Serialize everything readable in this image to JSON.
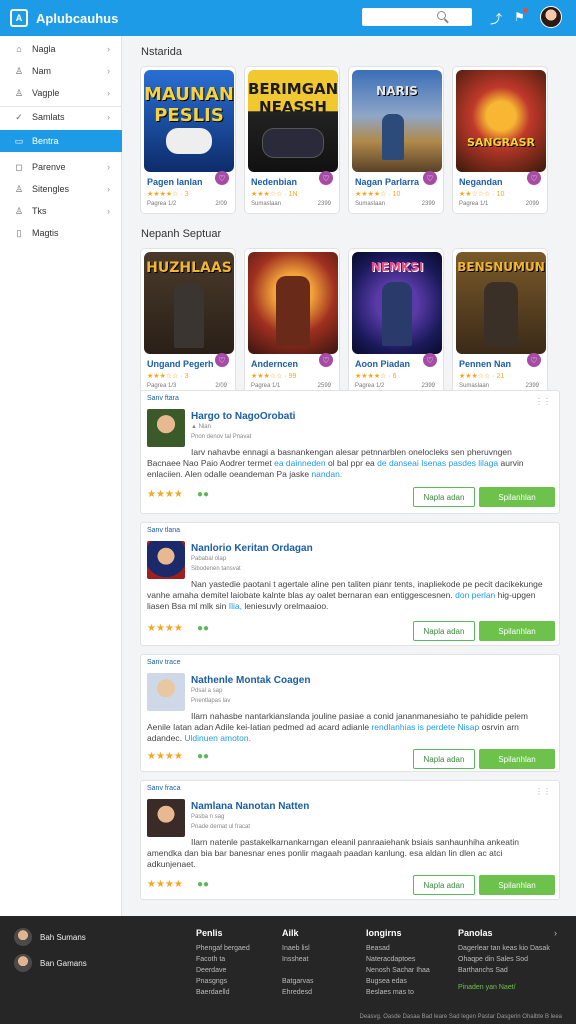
{
  "header": {
    "title": "Aplubcauhus",
    "logo_text": "A",
    "search_placeholder": "",
    "icons": [
      "search-icon",
      "share-icon",
      "notification-icon",
      "avatar"
    ]
  },
  "sidebar": {
    "items": [
      {
        "label": "Nagla",
        "icon": "home-icon"
      },
      {
        "label": "Nam",
        "icon": "user-icon"
      },
      {
        "label": "Vagple",
        "icon": "user-icon"
      },
      {
        "label": "Samlats",
        "icon": "check-icon"
      },
      {
        "label": "Bentra",
        "icon": "grid-icon",
        "active": true
      },
      {
        "label": "Parenve",
        "icon": "chat-icon"
      },
      {
        "label": "Sitengles",
        "icon": "people-icon"
      },
      {
        "label": "Tks",
        "icon": "person-icon"
      },
      {
        "label": "Magtis",
        "icon": "doc-icon"
      }
    ]
  },
  "sections": {
    "featured_title": "Nstarida",
    "popular_title": "Nepanh Septuar"
  },
  "featured_games": [
    {
      "art": "MAUNAN PESLIS",
      "name": "Pagen lanlan",
      "rating": "★★★★☆ · 3",
      "count": "39",
      "sub": "Pagrea 1/2",
      "num": "2/09"
    },
    {
      "art": "BERIMGAN NEASSH",
      "name": "Nedenbian",
      "rating": "★★★☆☆ · 1N",
      "count": "1N",
      "sub": "Sumaslaan",
      "num": "2399"
    },
    {
      "art": "NARIS",
      "name": "Nagan Parlarra",
      "rating": "★★★★☆ · 10",
      "count": "10",
      "sub": "Sumaslaan",
      "num": "2399"
    },
    {
      "art": "SANGRASR",
      "name": "Negandan",
      "rating": "★★☆☆☆ · 10",
      "count": "10",
      "sub": "Pagrea 1/1",
      "num": "2099"
    }
  ],
  "popular_games": [
    {
      "art": "HUZHLAAS",
      "name": "Ungand Pegerh",
      "rating": "★★★☆☆ · 3",
      "count": "80",
      "sub": "Pagrea 1/3",
      "num": "2/09"
    },
    {
      "art": "",
      "name": "Anderncen",
      "rating": "★★★☆☆ · 99",
      "count": "99",
      "sub": "Pagrea 1/1",
      "num": "2599"
    },
    {
      "art": "NEMKSI",
      "name": "Aoon Piadan",
      "rating": "★★★★☆ · 6",
      "count": "6",
      "sub": "Pagrea 1/2",
      "num": "2399"
    },
    {
      "art": "BENSNUMUN",
      "name": "Pennen Nan",
      "rating": "★★★☆☆ · 21",
      "count": "21",
      "sub": "Sumaslaan",
      "num": "2399"
    }
  ],
  "posts": [
    {
      "tag": "Sanv ftara",
      "title": "Hargo to NagoOrobati",
      "meta1": "▲ Nlan",
      "meta2": "Pnon denov tal Pnavat",
      "body_a": "Iarv nahavbe ennagi a basnankengan alesar petnnarblen onelocleks sen pheruvngen Bacnaee Nao Paio Aodrer termet ",
      "body_hl1": "ea dainneden",
      "body_b": " ol bal ppr ea ",
      "body_hl2": "de danseai Isenas pasdes lilaga",
      "body_c": " aurvin enlaciien. Alen odalle oeandeman Pa jaske ",
      "body_hl3": "nandan.",
      "stars": "★★★★",
      "btn1": "Napla adan",
      "btn2": "Spilanhlan"
    },
    {
      "tag": "Sanv tlana",
      "title": "Nanlorio Keritan Ordagan",
      "meta1": "Pababal olap",
      "meta2": "Sibodenen tansvat",
      "body_a": "Nan yastedie paotani t agertale aline pen taliten pianr tents, inapliekode pe pecit dacikekunge vanhe amaha demitel laiobate kalnte blas ay oalet bernaran ean entiggescesnen. ",
      "body_hl1": "don perlan",
      "body_b": " hig-upgen liasen Bsa ml mlk sin ",
      "body_hl2": "Ilia,",
      "body_c": " leniesuvly orelmaaioo. ",
      "body_hl3": "",
      "stars": "★★★★",
      "btn1": "Napla adan",
      "btn2": "Spilanhlan"
    },
    {
      "tag": "Sanv trace",
      "title": "Nathenle Montak Coagen",
      "meta1": "Pdsal a sap",
      "meta2": "Pnentlapas lav",
      "body_a": "Ilarn nahasbe nantarkianslanda jouline pasiae a conid jananmanesiaho te pahidide pelem Aenile Iatan adan Adile kei-Iatian pedmed ad acard adianle ",
      "body_hl1": "rendlanhias is perdete Nisap",
      "body_b": " osrvin arn adandec. ",
      "body_hl2": "Uldinuen amoton.",
      "body_c": "",
      "body_hl3": "",
      "stars": "★★★★",
      "btn1": "Napla adan",
      "btn2": "Spilanhlan"
    },
    {
      "tag": "Sanv fraca",
      "title": "Namlana Nanotan Natten",
      "meta1": "Pasba n sag",
      "meta2": "Pnade dernat ul fracat",
      "body_a": "Ilarn natenle pastakelkarnankarngan eleanil panraaiehank bsiais sanhaunhiha ankeatin amendka dan bia bar banesnar enes ponlir magaah paadan kanlung. esa aldan lin dlen ac atci adkunjenaet.",
      "body_hl1": "",
      "body_b": "",
      "body_hl2": "",
      "body_c": "",
      "body_hl3": "",
      "stars": "★★★★",
      "btn1": "Napla adan",
      "btn2": "Spilanhlan"
    }
  ],
  "footer": {
    "users": [
      "Bah Sumans",
      "Ban Gamans"
    ],
    "cols": [
      {
        "head": "Penlis",
        "lines": [
          "Phengaf bergaed",
          "Facoth ta",
          "Deerdave",
          "Pnasgngs",
          "Baerdaelld"
        ]
      },
      {
        "head": "Ailk",
        "lines": [
          "Inaeb lisl",
          "Inssheat",
          "",
          "Batgarvas",
          "Ehredesd"
        ]
      },
      {
        "head": "Iongirns",
        "lines": [
          "Beasad",
          "Nateracdaptoes",
          "Nenosh Sachar Ihaa",
          "Bugsea edas",
          "Beslaes mas to"
        ]
      },
      {
        "head": "Panolas",
        "lines": [
          "Dagerlear tan keas kio Dasak",
          "Ohaqpe din Sales Sod",
          "Barthanchs Sad"
        ]
      }
    ],
    "green_text": "Pinaden yan Naet/",
    "bottom": "Deasvg. Oasde Dasaa Bad leare Sad legen Pastar Dasgerin Ohalbte B leea"
  }
}
